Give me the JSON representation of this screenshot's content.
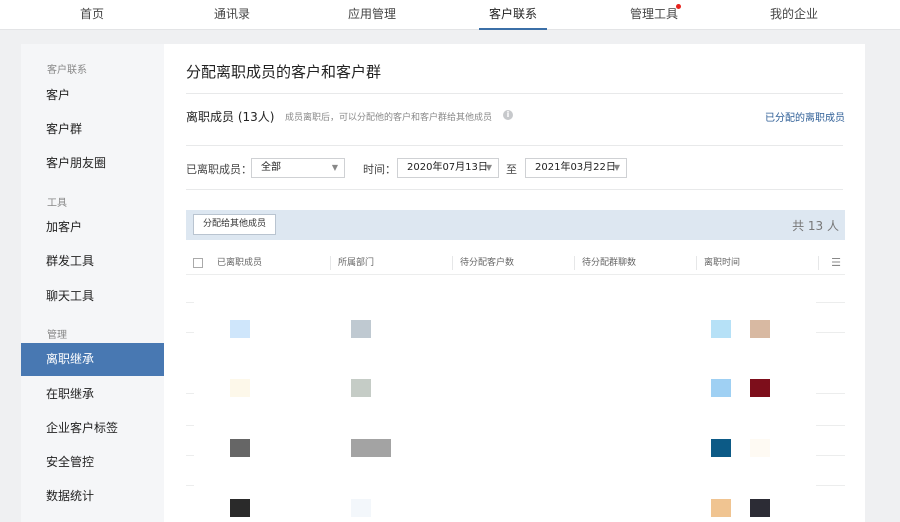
{
  "topnav": {
    "items": [
      "首页",
      "通讯录",
      "应用管理",
      "客户联系",
      "管理工具",
      "我的企业"
    ],
    "active_index": 3
  },
  "sidebar": {
    "groups": {
      "contact": "客户联系",
      "tools": "工具",
      "manage": "管理"
    },
    "items": [
      {
        "label": "客户"
      },
      {
        "label": "客户群"
      },
      {
        "label": "客户朋友圈"
      },
      {
        "label": "加客户"
      },
      {
        "label": "群发工具"
      },
      {
        "label": "聊天工具"
      },
      {
        "label": "离职继承"
      },
      {
        "label": "在职继承"
      },
      {
        "label": "企业客户标签"
      },
      {
        "label": "安全管控"
      },
      {
        "label": "数据统计"
      }
    ],
    "active_label": "离职继承"
  },
  "main": {
    "title": "分配离职成员的客户和客户群",
    "section_title": "离职成员 (13人)",
    "section_desc": "成员离职后，可以分配他的客户和客户群给其他成员",
    "assigned_link": "已分配的离职成员",
    "filters": {
      "member_label": "已离职成员：",
      "member_value": "全部",
      "time_label": "时间：",
      "start_date": "2020年07月13日",
      "to_label": "至",
      "end_date": "2021年03月22日"
    },
    "assign_button": "分配给其他成员",
    "total": "共 13 人",
    "columns": [
      "已离职成员",
      "所属部门",
      "待分配客户数",
      "待分配群聊数",
      "离职时间"
    ]
  },
  "colors": {
    "accent": "#4878b2",
    "toolbar_bg": "#dde7f1",
    "link": "#2f5f97",
    "badge": "#e7231d"
  }
}
